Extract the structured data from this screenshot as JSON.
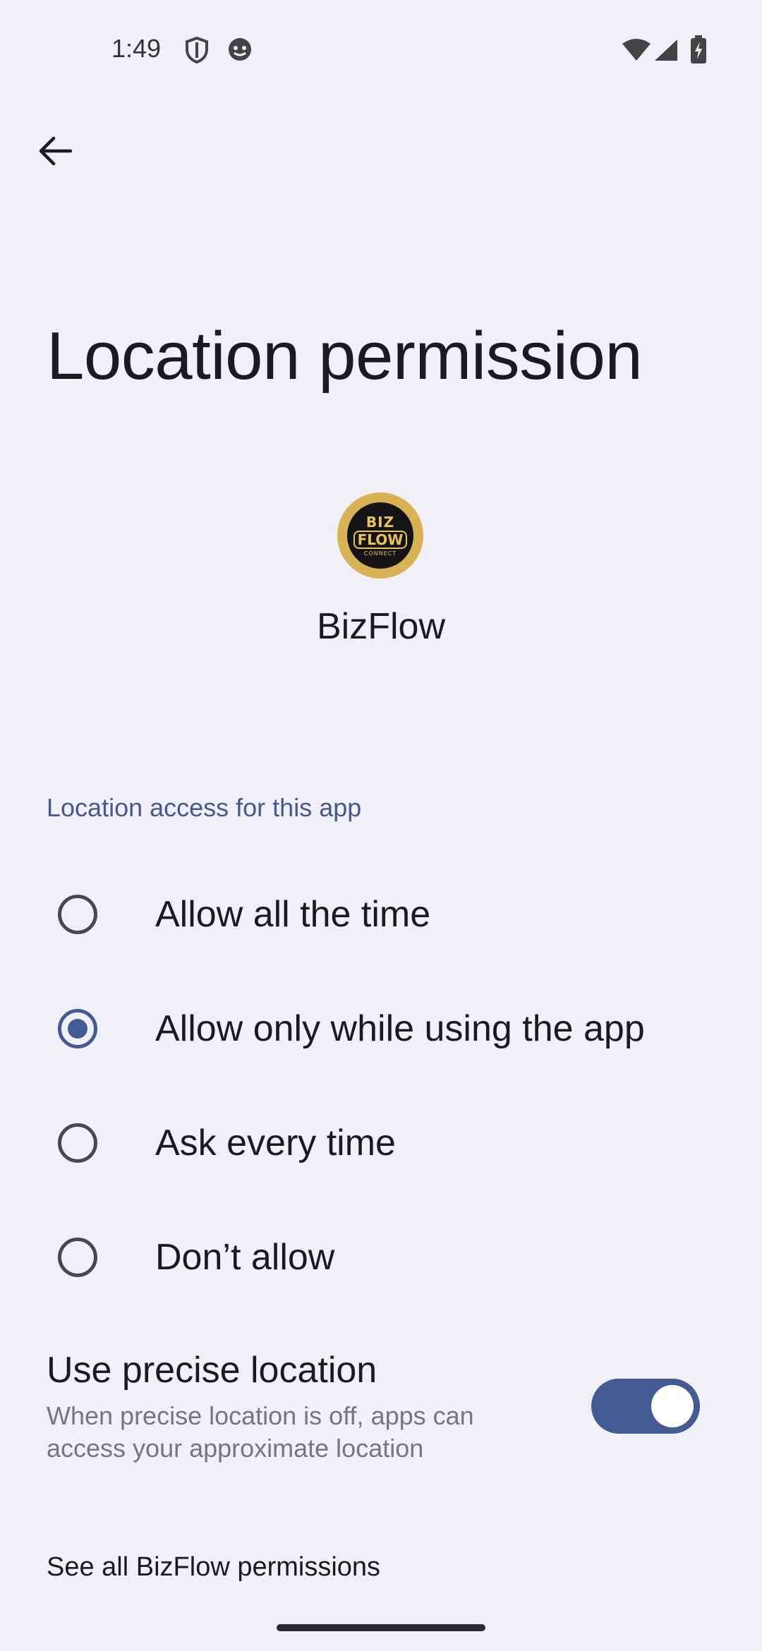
{
  "status_bar": {
    "time": "1:49",
    "icons": [
      "shield-icon",
      "notification-face-icon",
      "wifi-icon",
      "signal-icon",
      "battery-charging-icon"
    ]
  },
  "header": {
    "back_icon": "arrow-back-icon",
    "title": "Location permission"
  },
  "app": {
    "name": "BizFlow",
    "icon_text": [
      "BIZ",
      "FLOW",
      "CONNECT"
    ]
  },
  "section": {
    "header": "Location access for this app"
  },
  "options": [
    {
      "label": "Allow all the time",
      "checked": false
    },
    {
      "label": "Allow only while using the app",
      "checked": true
    },
    {
      "label": "Ask every time",
      "checked": false
    },
    {
      "label": "Don’t allow",
      "checked": false
    }
  ],
  "precise_location": {
    "title": "Use precise location",
    "description": "When precise location is off, apps can access your approximate location",
    "enabled": true
  },
  "footer": {
    "see_all": "See all BizFlow permissions"
  },
  "colors": {
    "background": "#f2f0f7",
    "accent": "#435a92",
    "section_header": "#44598f"
  }
}
